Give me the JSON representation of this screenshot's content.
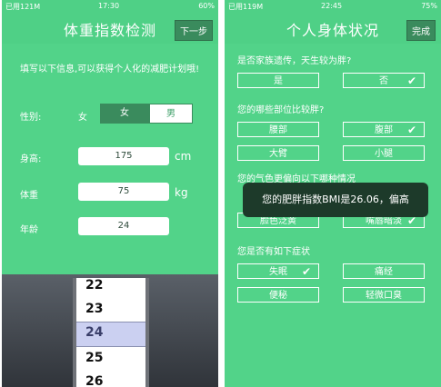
{
  "left": {
    "status": {
      "carrier": "已用121M",
      "time": "17:30",
      "battery": "60%"
    },
    "title": "体重指数检测",
    "next_label": "下一步",
    "intro": "填写以下信息,可以获得个人化的减肥计划哦!",
    "gender_label": "性别:",
    "gender_value": "女",
    "gender_options": {
      "female": "女",
      "male": "男"
    },
    "height_label": "身高:",
    "height_value": "175",
    "height_unit": "cm",
    "weight_label": "体重",
    "weight_value": "75",
    "weight_unit": "kg",
    "age_label": "年龄",
    "age_value": "24",
    "picker": {
      "rows": [
        "22",
        "23",
        "24",
        "25",
        "26"
      ],
      "selected": "24"
    }
  },
  "right": {
    "status": {
      "carrier": "已用119M",
      "time": "22:45",
      "battery": "75%"
    },
    "title": "个人身体状况",
    "done_label": "完成",
    "q1": "是否家族遗传，天生较为胖?",
    "q1_yes": "是",
    "q1_no": "否",
    "q2": "您的哪些部位比较胖?",
    "q2_waist": "腰部",
    "q2_belly": "腹部",
    "q2_arm": "大臂",
    "q2_calf": "小腿",
    "q3": "您的气色更偏向以下哪种情况",
    "q3_a": "脸色泛黄",
    "q3_b": "嘴唇暗淡",
    "q4": "您是否有如下症状",
    "q4_insomnia": "失眠",
    "q4_dysmenorrhea": "痛经",
    "q4_constipation": "便秘",
    "q4_breath": "轻微口臭",
    "toast": "您的肥胖指数BMI是26.06，偏高"
  },
  "colors": {
    "primary": "#52d389",
    "dark_button": "#3a8b5d",
    "toast": "#1d3a2a"
  }
}
